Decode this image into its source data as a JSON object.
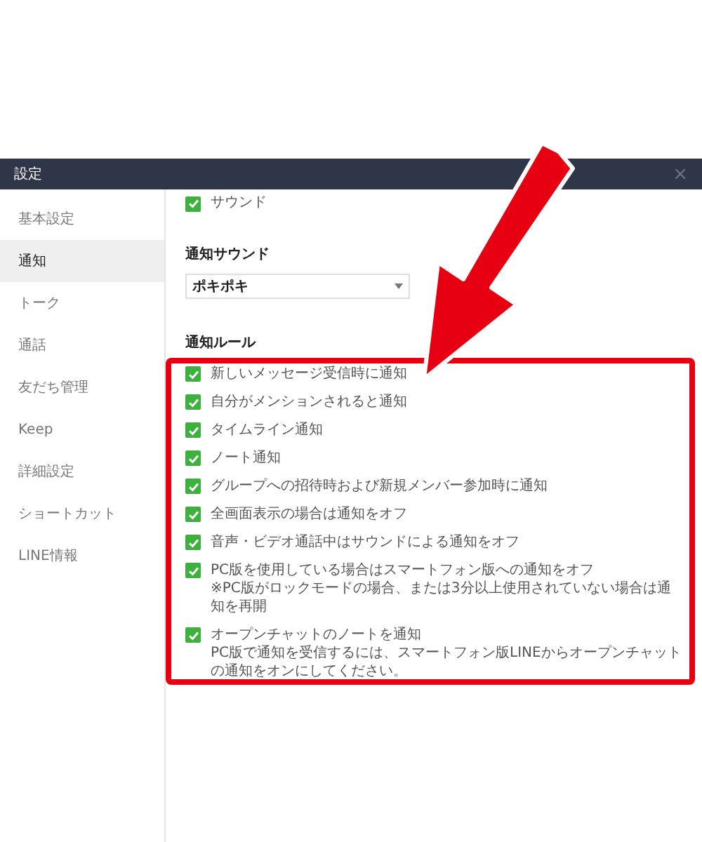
{
  "window": {
    "title": "設定",
    "close": "×"
  },
  "sidebar": {
    "items": [
      {
        "label": "基本設定",
        "selected": false
      },
      {
        "label": "通知",
        "selected": true
      },
      {
        "label": "トーク",
        "selected": false
      },
      {
        "label": "通話",
        "selected": false
      },
      {
        "label": "友だち管理",
        "selected": false
      },
      {
        "label": "Keep",
        "selected": false
      },
      {
        "label": "詳細設定",
        "selected": false
      },
      {
        "label": "ショートカット",
        "selected": false
      },
      {
        "label": "LINE情報",
        "selected": false
      }
    ]
  },
  "top_option": {
    "label": "サウンド",
    "checked": true
  },
  "sound": {
    "heading": "通知サウンド",
    "value": "ポキポキ"
  },
  "rules": {
    "heading": "通知ルール",
    "items": [
      {
        "label": "新しいメッセージ受信時に通知",
        "checked": true
      },
      {
        "label": "自分がメンションされると通知",
        "checked": true
      },
      {
        "label": "タイムライン通知",
        "checked": true
      },
      {
        "label": "ノート通知",
        "checked": true
      },
      {
        "label": "グループへの招待時および新規メンバー参加時に通知",
        "checked": true
      },
      {
        "label": "全画面表示の場合は通知をオフ",
        "checked": true
      },
      {
        "label": "音声・ビデオ通話中はサウンドによる通知をオフ",
        "checked": true
      },
      {
        "label": "PC版を使用している場合はスマートフォン版への通知をオフ",
        "note": "※PC版がロックモードの場合、または3分以上使用されていない場合は通知を再開",
        "checked": true
      },
      {
        "label": "オープンチャットのノートを通知",
        "note": "PC版で通知を受信するには、スマートフォン版LINEからオープンチャットの通知をオンにしてください。",
        "checked": true
      }
    ]
  }
}
